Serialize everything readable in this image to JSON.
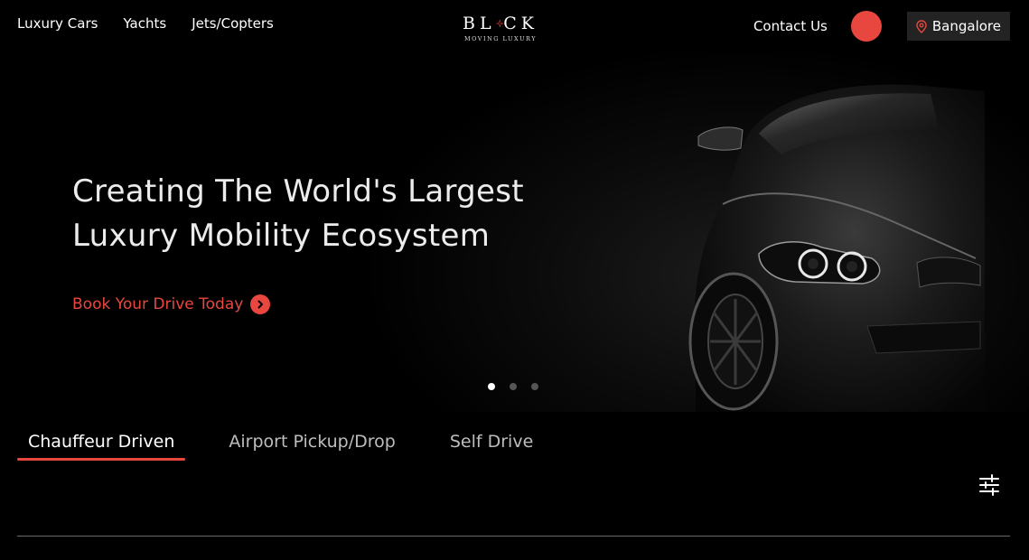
{
  "nav": {
    "links": [
      "Luxury Cars",
      "Yachts",
      "Jets/Copters"
    ],
    "contact_label": "Contact Us",
    "location_label": "Bangalore",
    "location_icon": "map-pin-icon"
  },
  "logo": {
    "word_left": "BL",
    "word_right": "CK",
    "tagline": "MOVING LUXURY"
  },
  "hero": {
    "title_line1": "Creating The World's Largest",
    "title_line2": "Luxury Mobility Ecosystem",
    "cta_label": "Book Your Drive Today",
    "cta_icon": "chevron-right-icon",
    "slides_total": 3,
    "active_slide": 1
  },
  "tabs": [
    {
      "label": "Chauffeur Driven",
      "active": true
    },
    {
      "label": "Airport Pickup/Drop",
      "active": false
    },
    {
      "label": "Self Drive",
      "active": false
    }
  ],
  "filter_icon": "sliders-icon",
  "colors": {
    "accent": "#e8473f",
    "background": "#000000",
    "location_bg": "#232323"
  }
}
